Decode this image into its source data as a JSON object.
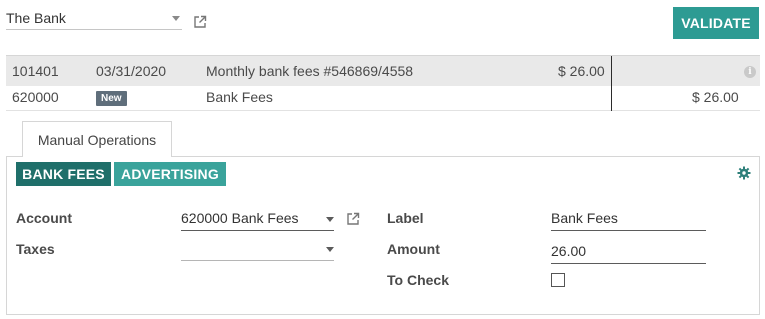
{
  "header": {
    "journal": "The Bank",
    "validate_label": "VALIDATE"
  },
  "lines": [
    {
      "account": "101401",
      "date": "03/31/2020",
      "label": "Monthly bank fees #546869/4558",
      "debit": "$ 26.00",
      "credit": ""
    },
    {
      "account": "620000",
      "badge": "New",
      "label": "Bank Fees",
      "debit": "",
      "credit": "$ 26.00"
    }
  ],
  "tabs": [
    {
      "label": "Manual Operations"
    }
  ],
  "models": [
    {
      "label": "BANK FEES"
    },
    {
      "label": "ADVERTISING"
    }
  ],
  "form": {
    "account_label": "Account",
    "account_value": "620000 Bank Fees",
    "taxes_label": "Taxes",
    "taxes_value": "",
    "label_label": "Label",
    "label_value": "Bank Fees",
    "amount_label": "Amount",
    "amount_value": "26.00",
    "to_check_label": "To Check",
    "to_check_checked": false
  },
  "icons": {
    "external_link": "external-link-icon",
    "info": "info-icon",
    "settings": "gear-icon",
    "dropdown": "chevron-down-icon"
  },
  "colors": {
    "accent": "#2d9b93",
    "model_primary": "#1f6f6a",
    "model_secondary": "#3aa39b",
    "badge": "#5f6e7b"
  }
}
